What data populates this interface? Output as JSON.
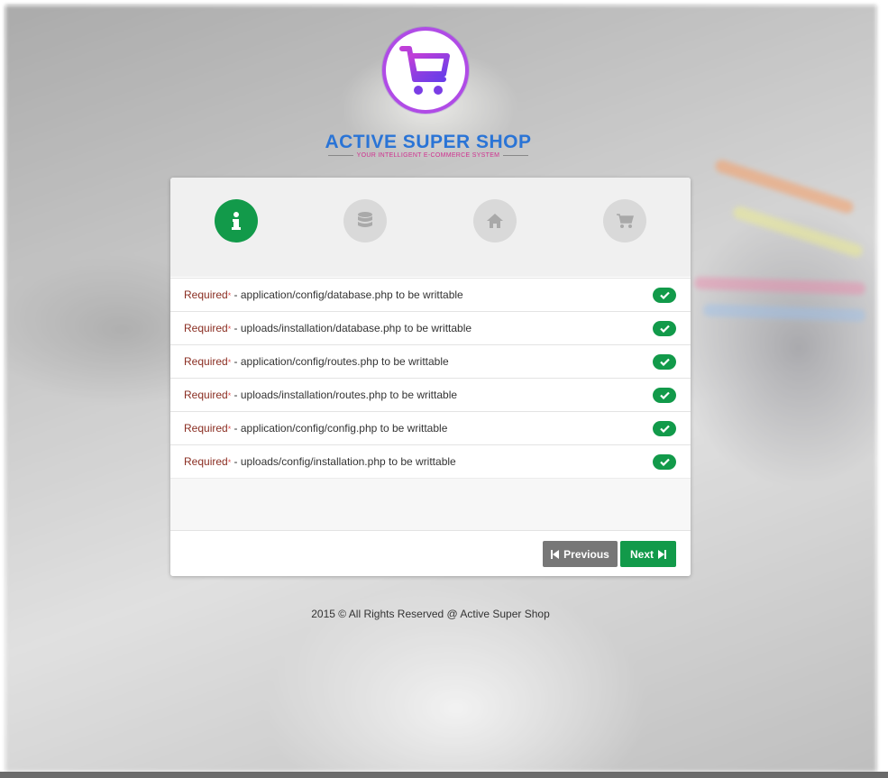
{
  "brand": {
    "title": "ACTIVE SUPER SHOP",
    "tagline": "YOUR INTELLIGENT E-COMMERCE SYSTEM"
  },
  "wizard": {
    "steps": [
      {
        "icon": "info-icon",
        "active": true
      },
      {
        "icon": "database-icon",
        "active": false
      },
      {
        "icon": "home-icon",
        "active": false
      },
      {
        "icon": "cart-icon",
        "active": false
      }
    ],
    "requirements": [
      {
        "label": "Required",
        "star": "*",
        "text": " - application/config/database.php to be writtable",
        "status": "check-icon"
      },
      {
        "label": "Required",
        "star": "*",
        "text": " - uploads/installation/database.php to be writtable",
        "status": "check-icon"
      },
      {
        "label": "Required",
        "star": "*",
        "text": " - application/config/routes.php to be writtable",
        "status": "check-icon"
      },
      {
        "label": "Required",
        "star": "*",
        "text": " - uploads/installation/routes.php to be writtable",
        "status": "check-icon"
      },
      {
        "label": "Required",
        "star": "*",
        "text": " - application/config/config.php to be writtable",
        "status": "check-icon"
      },
      {
        "label": "Required",
        "star": "*",
        "text": " - uploads/config/installation.php to be writtable",
        "status": "check-icon"
      }
    ],
    "buttons": {
      "previous": "Previous",
      "next": "Next"
    }
  },
  "footer": {
    "copyright": "2015 © All Rights Reserved @ Active Super Shop"
  },
  "colors": {
    "success": "#129a4a",
    "muted": "#777777",
    "brand_blue": "#2a74d6",
    "required_text": "#8a2e22"
  }
}
